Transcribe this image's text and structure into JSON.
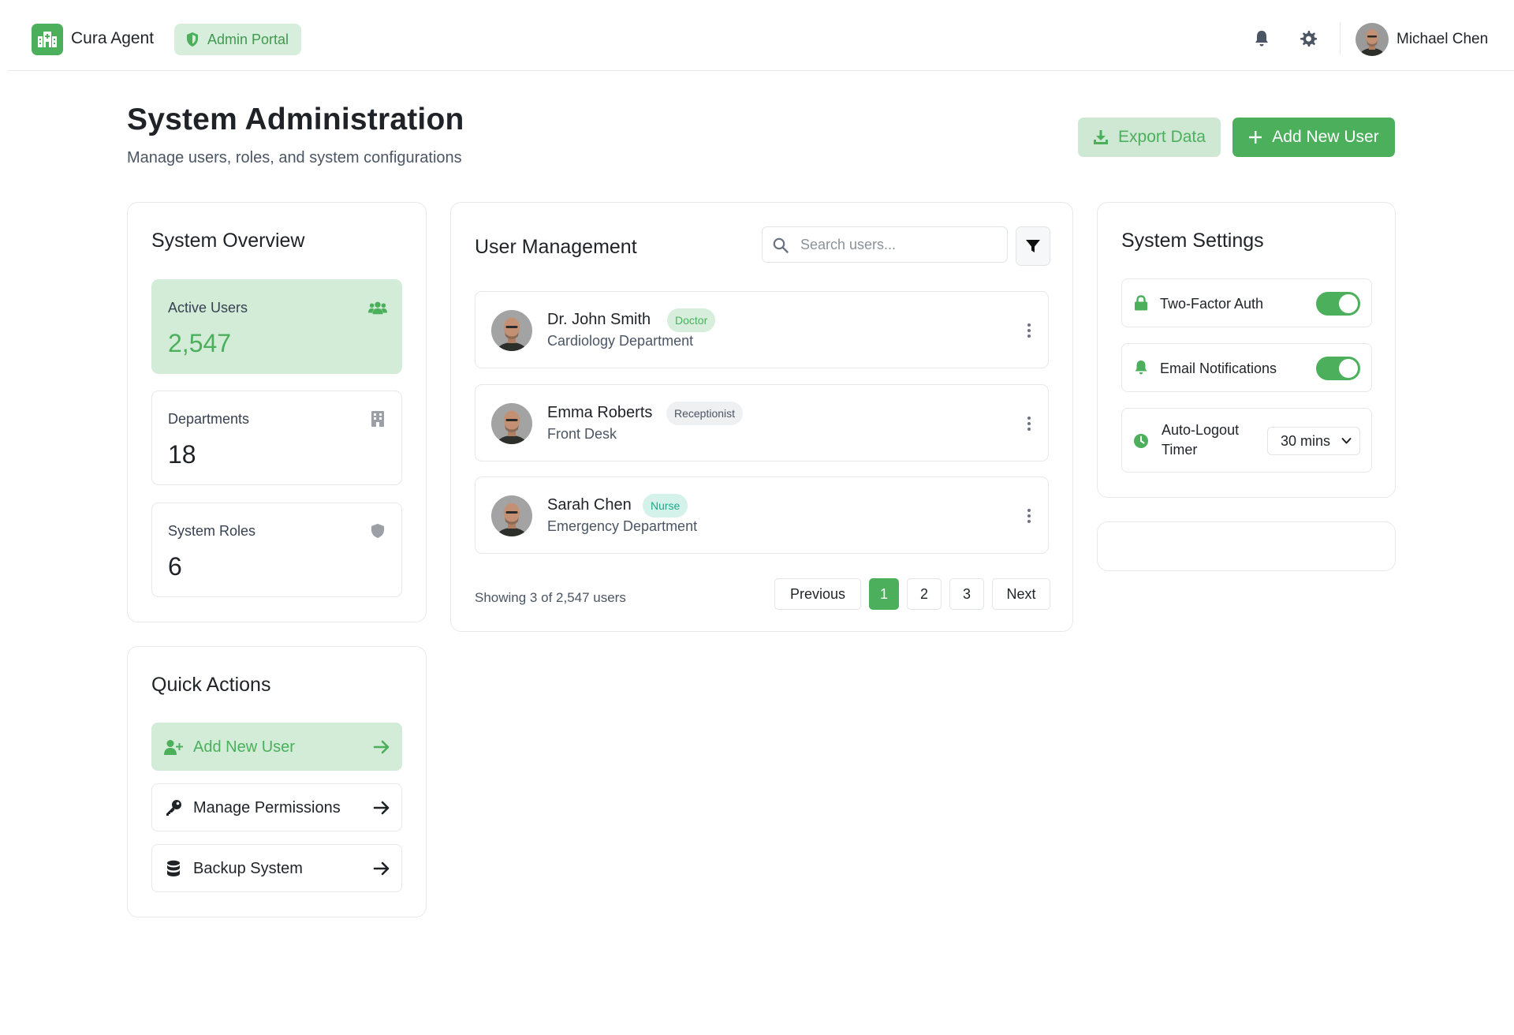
{
  "header": {
    "brand": "Cura Agent",
    "portal_badge": "Admin Portal",
    "user_name": "Michael Chen",
    "icons": [
      "hospital-icon",
      "shield-icon",
      "bell-icon",
      "gear-icon"
    ]
  },
  "page": {
    "title": "System Administration",
    "subtitle": "Manage users, roles, and system configurations",
    "export_label": "Export Data",
    "add_user_label": "Add New User"
  },
  "overview": {
    "title": "System Overview",
    "stats": [
      {
        "label": "Active Users",
        "value": "2,547",
        "icon": "users-icon"
      },
      {
        "label": "Departments",
        "value": "18",
        "icon": "building-icon"
      },
      {
        "label": "System Roles",
        "value": "6",
        "icon": "shield-icon"
      }
    ]
  },
  "quick_actions": {
    "title": "Quick Actions",
    "items": [
      {
        "label": "Add New User",
        "icon": "user-plus-icon"
      },
      {
        "label": "Manage Permissions",
        "icon": "key-icon"
      },
      {
        "label": "Backup System",
        "icon": "database-icon"
      }
    ]
  },
  "users": {
    "title": "User Management",
    "search_placeholder": "Search users...",
    "list": [
      {
        "name": "Dr. John Smith",
        "role": "Doctor",
        "department": "Cardiology Department"
      },
      {
        "name": "Emma Roberts",
        "role": "Receptionist",
        "department": "Front Desk"
      },
      {
        "name": "Sarah Chen",
        "role": "Nurse",
        "department": "Emergency Department"
      }
    ],
    "showing": "Showing 3 of 2,547 users",
    "pagination": {
      "previous": "Previous",
      "pages": [
        "1",
        "2",
        "3"
      ],
      "current": "1",
      "next": "Next"
    }
  },
  "settings": {
    "title": "System Settings",
    "two_factor": {
      "label": "Two-Factor Auth",
      "enabled": true
    },
    "email_notifications": {
      "label": "Email Notifications",
      "enabled": true
    },
    "auto_logout": {
      "label_line1": "Auto-Logout",
      "label_line2": "Timer",
      "value": "30 mins"
    }
  },
  "colors": {
    "accent": "#4caf5c",
    "accent_light": "#d2ecd8",
    "doctor_badge_bg": "#d6eedb",
    "receptionist_badge_bg": "#eef0f2",
    "nurse_badge_bg": "#d4f1ea",
    "nurse_badge_text": "#1fa98a"
  }
}
